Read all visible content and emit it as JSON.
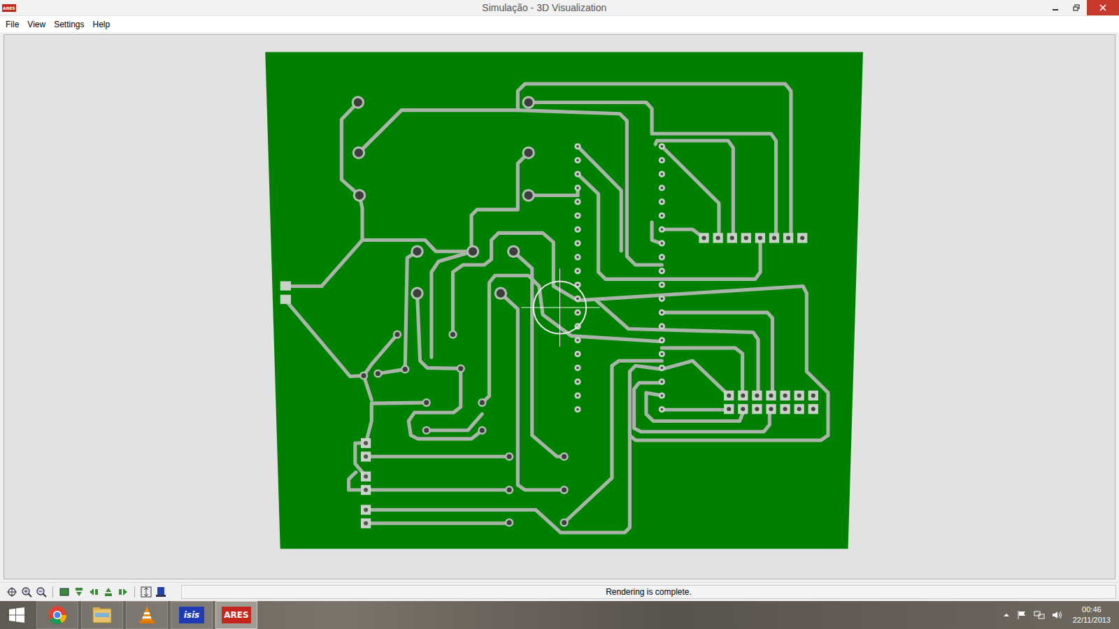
{
  "window": {
    "title": "Simulação - 3D Visualization",
    "app_badge": "ARES"
  },
  "menu": [
    {
      "label": "File"
    },
    {
      "label": "View"
    },
    {
      "label": "Settings"
    },
    {
      "label": "Help"
    }
  ],
  "status_bar": {
    "message": "Rendering is complete."
  },
  "taskbar": {
    "apps": [
      {
        "kind": "chrome",
        "label": "",
        "selected": false
      },
      {
        "kind": "explorer",
        "label": "",
        "selected": false
      },
      {
        "kind": "vlc",
        "label": "",
        "selected": false
      },
      {
        "kind": "isis",
        "label": "isis",
        "selected": false
      },
      {
        "kind": "ares",
        "label": "ARES",
        "selected": true
      }
    ],
    "clock": {
      "time": "00:46",
      "date": "22/11/2013"
    }
  }
}
